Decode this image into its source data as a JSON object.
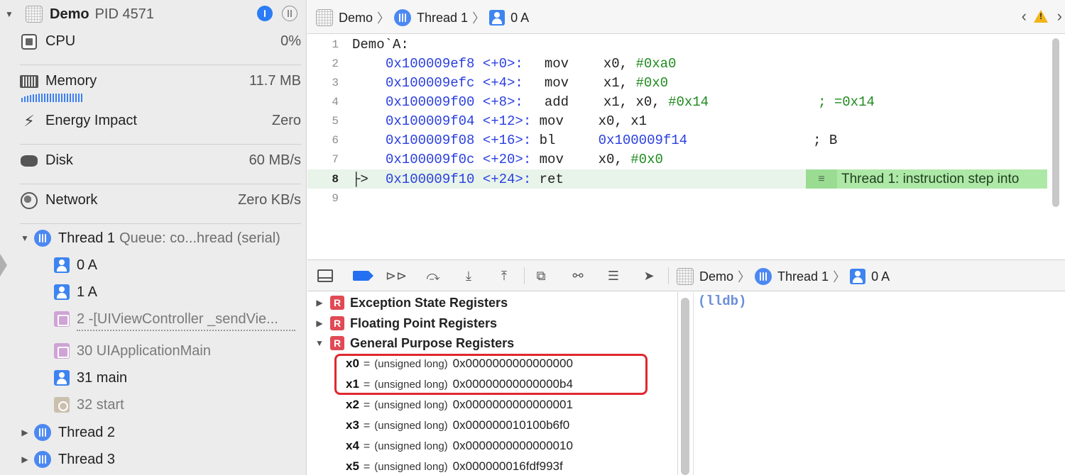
{
  "navigator": {
    "process": {
      "name": "Demo",
      "pid": "PID 4571"
    },
    "gauges": [
      {
        "label": "CPU",
        "value": "0%",
        "icon": "cpu-icon"
      },
      {
        "label": "Memory",
        "value": "11.7 MB",
        "icon": "memory-icon"
      },
      {
        "label": "Energy Impact",
        "value": "Zero",
        "icon": "bolt-icon"
      },
      {
        "label": "Disk",
        "value": "60 MB/s",
        "icon": "disk-icon"
      },
      {
        "label": "Network",
        "value": "Zero KB/s",
        "icon": "globe-icon"
      }
    ],
    "thread1": {
      "name": "Thread 1",
      "queue": "Queue: co...hread (serial)"
    },
    "frames": [
      {
        "label": "0 A",
        "kind": "user"
      },
      {
        "label": "1 A",
        "kind": "user"
      },
      {
        "label": "2 -[UIViewController _sendVie...",
        "kind": "system"
      },
      {
        "label": "30 UIApplicationMain",
        "kind": "system"
      },
      {
        "label": "31 main",
        "kind": "user"
      },
      {
        "label": "32 start",
        "kind": "start"
      }
    ],
    "thread2": {
      "name": "Thread 2"
    },
    "thread3": {
      "name": "Thread 3"
    }
  },
  "editor_bar": {
    "project": "Demo",
    "thread": "Thread 1",
    "frame": "0 A"
  },
  "code": {
    "header": "Demo`A:",
    "lines": [
      {
        "ln": "1"
      },
      {
        "ln": "2",
        "addr": "0x100009ef8",
        "off": "<+0>:",
        "op": "mov",
        "args": "x0, ",
        "num": "#0xa0",
        "cmt": ""
      },
      {
        "ln": "3",
        "addr": "0x100009efc",
        "off": "<+4>:",
        "op": "mov",
        "args": "x1, ",
        "num": "#0x0",
        "cmt": ""
      },
      {
        "ln": "4",
        "addr": "0x100009f00",
        "off": "<+8>:",
        "op": "add",
        "args": "x1, x0, ",
        "num": "#0x14",
        "cmt": "; =0x14"
      },
      {
        "ln": "5",
        "addr": "0x100009f04",
        "off": "<+12>:",
        "op": "mov",
        "args": "x0, x1",
        "num": "",
        "cmt": ""
      },
      {
        "ln": "6",
        "addr": "0x100009f08",
        "off": "<+16>:",
        "op": "bl",
        "args": "",
        "num": "",
        "addrArg": "0x100009f14",
        "cmt": "; B"
      },
      {
        "ln": "7",
        "addr": "0x100009f0c",
        "off": "<+20>:",
        "op": "mov",
        "args": "x0, ",
        "num": "#0x0",
        "cmt": ""
      },
      {
        "ln": "8",
        "addr": "0x100009f10",
        "off": "<+24>:",
        "op": "ret",
        "args": "",
        "num": "",
        "cmt": "",
        "pc": "├>"
      },
      {
        "ln": "9"
      }
    ],
    "annotation": "Thread 1: instruction step into"
  },
  "debug_bar": {
    "project": "Demo",
    "thread": "Thread 1",
    "frame": "0 A"
  },
  "variables": {
    "groups": [
      {
        "name": "Exception State Registers",
        "badge": "R"
      },
      {
        "name": "Floating Point Registers",
        "badge": "R"
      },
      {
        "name": "General Purpose Registers",
        "badge": "R"
      }
    ],
    "registers": [
      {
        "name": "x0",
        "eq": "=",
        "type": "(unsigned long)",
        "value": "0x0000000000000000"
      },
      {
        "name": "x1",
        "eq": "=",
        "type": "(unsigned long)",
        "value": "0x00000000000000b4"
      },
      {
        "name": "x2",
        "eq": "=",
        "type": "(unsigned long)",
        "value": "0x0000000000000001"
      },
      {
        "name": "x3",
        "eq": "=",
        "type": "(unsigned long)",
        "value": "0x000000010100b6f0"
      },
      {
        "name": "x4",
        "eq": "=",
        "type": "(unsigned long)",
        "value": "0x0000000000000010"
      },
      {
        "name": "x5",
        "eq": "=",
        "type": "(unsigned long)",
        "value": "0x000000016fdf993f"
      }
    ]
  },
  "console": {
    "prompt": "(lldb)"
  },
  "colors": {
    "accent": "#2b7cf6",
    "highlight": "#e0282f",
    "pc_line": "#e8f4ea",
    "annotation": "#aee8a7"
  }
}
